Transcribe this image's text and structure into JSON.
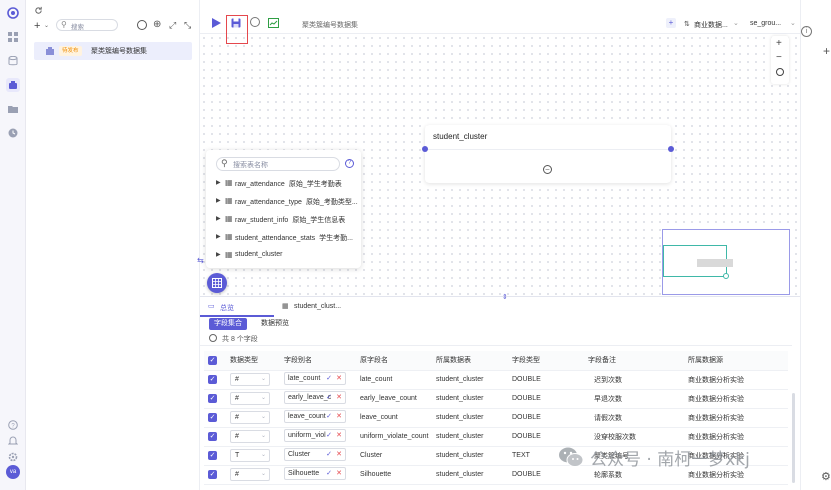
{
  "left_rail": {
    "items": [
      "logo-icon",
      "grid-icon",
      "database-icon",
      "dataset-icon",
      "folder-icon",
      "clock-icon"
    ],
    "bottom": [
      "help-icon",
      "bell-icon",
      "settings-icon"
    ],
    "avatar": "va"
  },
  "tree": {
    "search_placeholder": "搜索",
    "item": {
      "badge": "待发布",
      "label": "聚类簇编号数据集"
    }
  },
  "toolbar": {
    "dataset_name": "聚类簇编号数据集",
    "model_select": "商业数据...",
    "right_select": "se_grou..."
  },
  "canvas": {
    "node_title": "student_cluster",
    "zoom_in": "+",
    "zoom_out": "−"
  },
  "table_picker": {
    "placeholder": "搜索表名称",
    "items": [
      {
        "name": "raw_attendance",
        "desc": "原始_学生考勤表"
      },
      {
        "name": "raw_attendance_type",
        "desc": "原始_考勤类型..."
      },
      {
        "name": "raw_student_info",
        "desc": "原始_学生信息表"
      },
      {
        "name": "student_attendance_stats",
        "desc": "学生考勤..."
      },
      {
        "name": "student_cluster",
        "desc": ""
      }
    ]
  },
  "bottom": {
    "tabs": [
      "总览",
      "student_clust..."
    ],
    "subtabs": [
      "字段集合",
      "数据预览"
    ],
    "count": "共 8 个字段",
    "columns": [
      "数据类型",
      "字段别名",
      "原字段名",
      "所属数据表",
      "字段类型",
      "字段备注",
      "所属数据源"
    ],
    "rows": [
      {
        "type": "#",
        "alias": "late_count",
        "orig": "late_count",
        "table": "student_cluster",
        "ftype": "DOUBLE",
        "note": "迟到次数",
        "source": "商业数据分析实验"
      },
      {
        "type": "#",
        "alias": "early_leave_c",
        "orig": "early_leave_count",
        "table": "student_cluster",
        "ftype": "DOUBLE",
        "note": "早退次数",
        "source": "商业数据分析实验"
      },
      {
        "type": "#",
        "alias": "leave_count",
        "orig": "leave_count",
        "table": "student_cluster",
        "ftype": "DOUBLE",
        "note": "请假次数",
        "source": "商业数据分析实验"
      },
      {
        "type": "#",
        "alias": "uniform_viol",
        "orig": "uniform_violate_count",
        "table": "student_cluster",
        "ftype": "DOUBLE",
        "note": "没穿校服次数",
        "source": "商业数据分析实验"
      },
      {
        "type": "T",
        "alias": "Cluster",
        "orig": "Cluster",
        "table": "student_cluster",
        "ftype": "TEXT",
        "note": "聚类簇编号",
        "source": "商业数据分析实验"
      },
      {
        "type": "#",
        "alias": "Silhouette",
        "orig": "Silhouette",
        "table": "student_cluster",
        "ftype": "DOUBLE",
        "note": "轮廓系数",
        "source": "商业数据分析实验"
      }
    ]
  },
  "watermark": "公众号 · 南柯一梦xkj",
  "colors": {
    "accent": "#5b5bd6",
    "highlight_box": "#e5484d",
    "minimap_accent": "#3fb8a8"
  }
}
